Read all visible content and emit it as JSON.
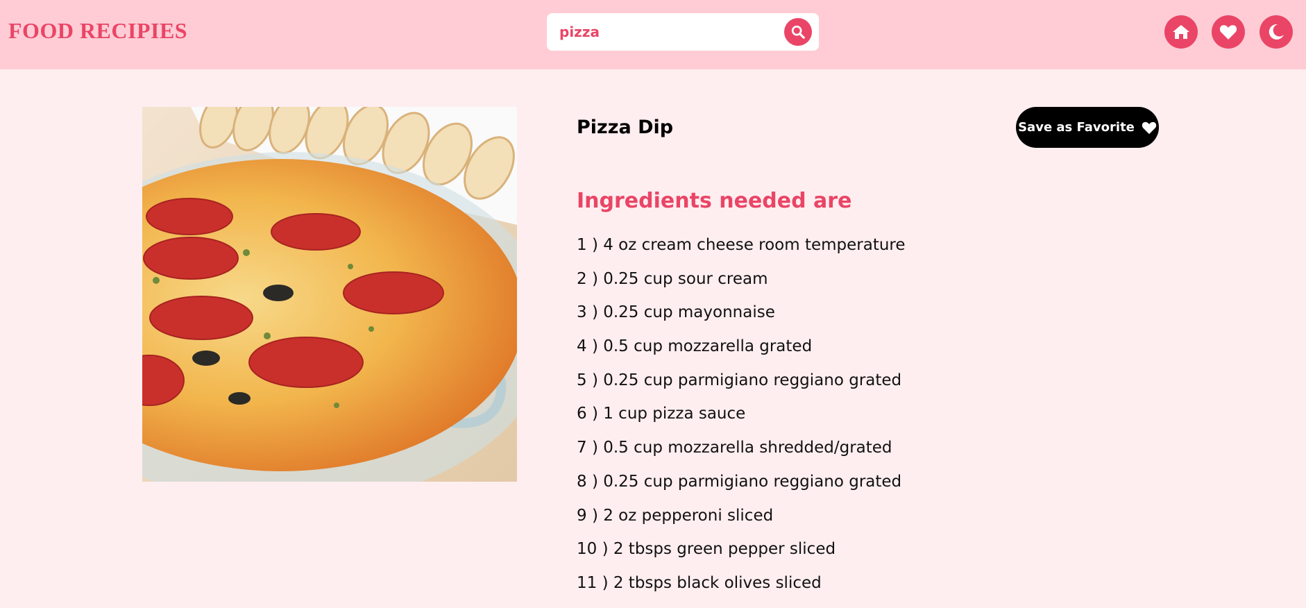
{
  "header": {
    "brand": "FOOD RECIPIES",
    "search": {
      "value": "pizza"
    },
    "nav": [
      "home-icon",
      "heart-icon",
      "moon-icon"
    ]
  },
  "recipe": {
    "title": "Pizza Dip",
    "save_label": "Save as Favorite",
    "ingredients_heading": "Ingredients needed are",
    "ingredients": [
      "1 ) 4 oz cream cheese room temperature",
      "2 ) 0.25 cup sour cream",
      "3 ) 0.25 cup mayonnaise",
      "4 ) 0.5 cup mozzarella grated",
      "5 ) 0.25 cup parmigiano reggiano grated",
      "6 ) 1 cup pizza sauce",
      "7 ) 0.5 cup mozzarella shredded/grated",
      "8 ) 0.25 cup parmigiano reggiano grated",
      "9 ) 2 oz pepperoni sliced",
      "10 ) 2 tbsps green pepper sliced",
      "11 ) 2 tbsps black olives sliced"
    ]
  },
  "colors": {
    "accent": "#ea4566",
    "header_bg": "#ffccd5",
    "page_bg": "#ffeef0",
    "button_dark": "#000000"
  }
}
